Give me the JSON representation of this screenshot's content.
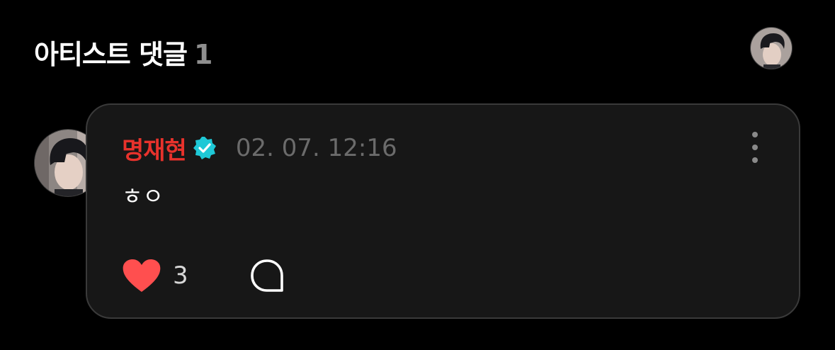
{
  "header": {
    "title": "아티스트 댓글",
    "count": "1",
    "avatar_icon": "artist-avatar-photo"
  },
  "comment": {
    "author": "명재현",
    "verified_icon": "verified-badge-icon",
    "timestamp": "02. 07. 12:16",
    "text": "ㅎㅇ",
    "like_count": "3",
    "like_icon": "heart-icon",
    "reply_icon": "reply-bubble-icon",
    "more_icon": "more-vertical-icon"
  },
  "colors": {
    "background": "#000000",
    "card_background": "#171717",
    "card_border": "#3a3a3a",
    "author_name": "#e8322c",
    "verified_badge": "#1ec8d6",
    "timestamp": "#6b6b6b",
    "heart": "#ff4f4f",
    "count_text": "#8e8e8e"
  }
}
